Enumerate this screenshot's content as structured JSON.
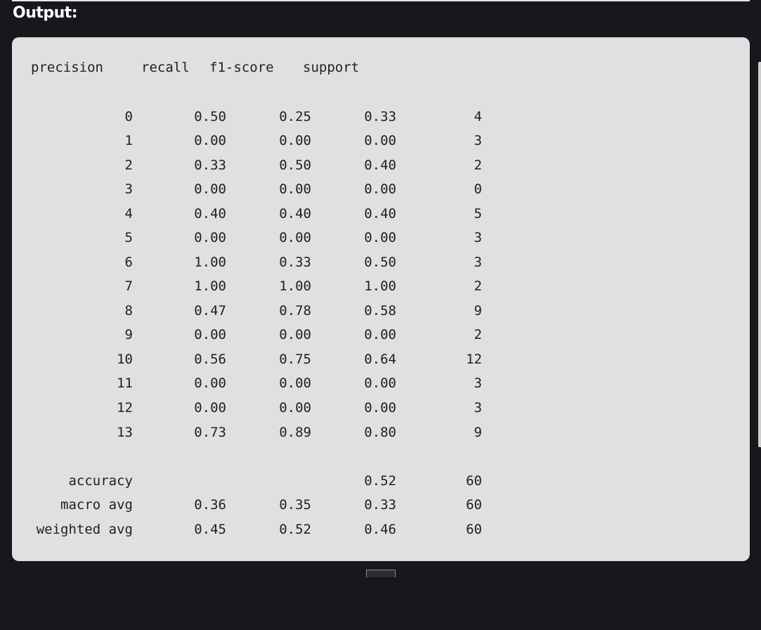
{
  "heading": "Output:",
  "report": {
    "headers": [
      "precision",
      "recall",
      "f1-score",
      "support"
    ],
    "rows": [
      {
        "label": "0",
        "precision": "0.50",
        "recall": "0.25",
        "f1": "0.33",
        "support": "4"
      },
      {
        "label": "1",
        "precision": "0.00",
        "recall": "0.00",
        "f1": "0.00",
        "support": "3"
      },
      {
        "label": "2",
        "precision": "0.33",
        "recall": "0.50",
        "f1": "0.40",
        "support": "2"
      },
      {
        "label": "3",
        "precision": "0.00",
        "recall": "0.00",
        "f1": "0.00",
        "support": "0"
      },
      {
        "label": "4",
        "precision": "0.40",
        "recall": "0.40",
        "f1": "0.40",
        "support": "5"
      },
      {
        "label": "5",
        "precision": "0.00",
        "recall": "0.00",
        "f1": "0.00",
        "support": "3"
      },
      {
        "label": "6",
        "precision": "1.00",
        "recall": "0.33",
        "f1": "0.50",
        "support": "3"
      },
      {
        "label": "7",
        "precision": "1.00",
        "recall": "1.00",
        "f1": "1.00",
        "support": "2"
      },
      {
        "label": "8",
        "precision": "0.47",
        "recall": "0.78",
        "f1": "0.58",
        "support": "9"
      },
      {
        "label": "9",
        "precision": "0.00",
        "recall": "0.00",
        "f1": "0.00",
        "support": "2"
      },
      {
        "label": "10",
        "precision": "0.56",
        "recall": "0.75",
        "f1": "0.64",
        "support": "12"
      },
      {
        "label": "11",
        "precision": "0.00",
        "recall": "0.00",
        "f1": "0.00",
        "support": "3"
      },
      {
        "label": "12",
        "precision": "0.00",
        "recall": "0.00",
        "f1": "0.00",
        "support": "3"
      },
      {
        "label": "13",
        "precision": "0.73",
        "recall": "0.89",
        "f1": "0.80",
        "support": "9"
      }
    ],
    "summary": [
      {
        "label": "accuracy",
        "precision": "",
        "recall": "",
        "f1": "0.52",
        "support": "60"
      },
      {
        "label": "macro avg",
        "precision": "0.36",
        "recall": "0.35",
        "f1": "0.33",
        "support": "60"
      },
      {
        "label": "weighted avg",
        "precision": "0.45",
        "recall": "0.52",
        "f1": "0.46",
        "support": "60"
      }
    ]
  },
  "colors": {
    "page_background": "#16181d",
    "panel_background": "#e0e0e0",
    "text": "#1f1f1f",
    "heading_text": "#ffffff"
  }
}
